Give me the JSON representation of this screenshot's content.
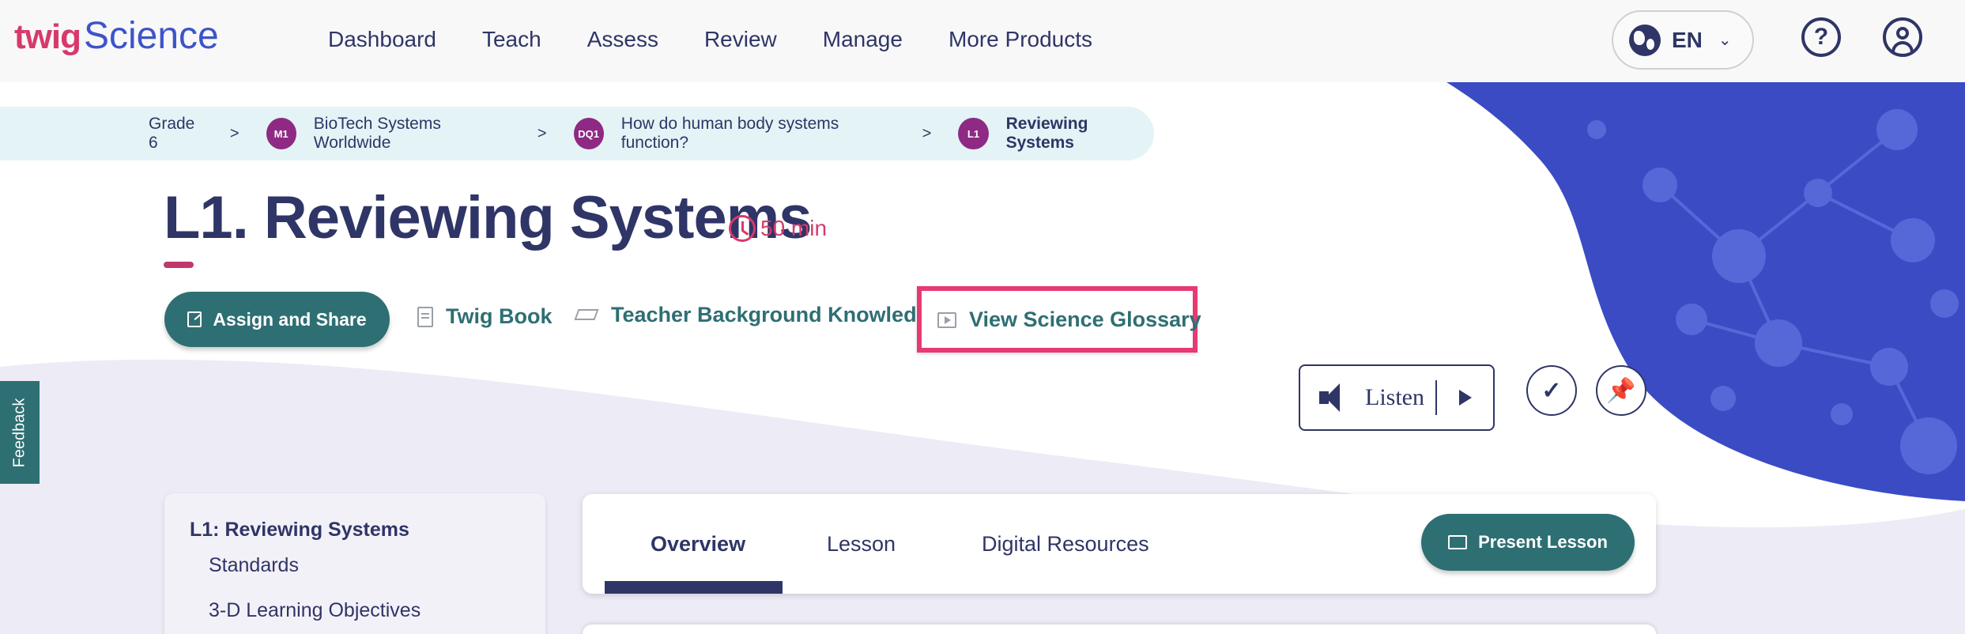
{
  "header": {
    "logo_twig": "twig",
    "logo_science": "Science",
    "nav": [
      "Dashboard",
      "Teach",
      "Assess",
      "Review",
      "Manage",
      "More Products"
    ],
    "language": "EN",
    "help_glyph": "?"
  },
  "breadcrumb": {
    "grade": "Grade 6",
    "separator": ">",
    "items": [
      {
        "badge": "M1",
        "label": "BioTech Systems Worldwide"
      },
      {
        "badge": "DQ1",
        "label": "How do human body systems function?"
      },
      {
        "badge": "L1",
        "label": "Reviewing Systems"
      }
    ]
  },
  "lesson": {
    "title": "L1. Reviewing Systems",
    "duration": "50 min"
  },
  "actions": {
    "assign_share": "Assign and Share",
    "twig_book": "Twig Book",
    "teacher_background": "Teacher Background Knowledge",
    "view_glossary": "View Science Glossary"
  },
  "listen": {
    "label": "Listen"
  },
  "feedback_label": "Feedback",
  "sidebar": {
    "title": "L1: Reviewing Systems",
    "items": [
      "Standards",
      "3-D Learning Objectives"
    ]
  },
  "tabs": {
    "items": [
      "Overview",
      "Lesson",
      "Digital Resources"
    ],
    "active": "Overview",
    "present_lesson": "Present Lesson"
  },
  "colors": {
    "navy": "#2f3566",
    "teal": "#2e6f73",
    "pink": "#d63a6b",
    "highlight": "#e73a72",
    "blue_decor": "#3a4bc4",
    "lavender": "#edebf5",
    "badge": "#8e2a83"
  }
}
